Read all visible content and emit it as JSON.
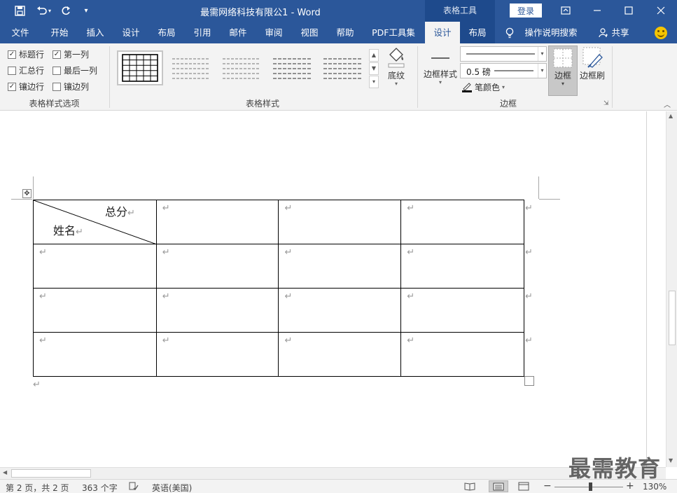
{
  "titlebar": {
    "doc_title": "最需网络科技有限公1  -  Word",
    "context_tab_group": "表格工具",
    "login": "登录"
  },
  "tabs": [
    {
      "label": "文件",
      "state": "normal"
    },
    {
      "label": "开始",
      "state": "normal"
    },
    {
      "label": "插入",
      "state": "normal"
    },
    {
      "label": "设计",
      "state": "normal"
    },
    {
      "label": "布局",
      "state": "normal"
    },
    {
      "label": "引用",
      "state": "normal"
    },
    {
      "label": "邮件",
      "state": "normal"
    },
    {
      "label": "审阅",
      "state": "normal"
    },
    {
      "label": "视图",
      "state": "normal"
    },
    {
      "label": "帮助",
      "state": "normal"
    },
    {
      "label": "PDF工具集",
      "state": "normal"
    },
    {
      "label": "设计",
      "state": "active"
    },
    {
      "label": "布局",
      "state": "context"
    }
  ],
  "tell_me": "操作说明搜索",
  "share": "共享",
  "ribbon": {
    "style_options": {
      "group_label": "表格样式选项",
      "checkboxes": [
        {
          "label": "标题行",
          "checked": true
        },
        {
          "label": "第一列",
          "checked": true
        },
        {
          "label": "汇总行",
          "checked": false
        },
        {
          "label": "最后一列",
          "checked": false
        },
        {
          "label": "镶边行",
          "checked": true
        },
        {
          "label": "镶边列",
          "checked": false
        }
      ]
    },
    "table_styles": {
      "group_label": "表格样式",
      "shading_label": "底纹"
    },
    "borders": {
      "group_label": "边框",
      "border_styles_label": "边框样式",
      "pen_weight": "0.5 磅",
      "pen_color_label": "笔颜色",
      "borders_label": "边框",
      "border_painter_label": "边框刷"
    }
  },
  "document": {
    "table": {
      "diagonal_header": {
        "top_right": "总分",
        "bottom_left": "姓名"
      },
      "rows": 4,
      "cols": 4,
      "cell_mark": "↵"
    },
    "end_mark": "↵"
  },
  "statusbar": {
    "page": "第 2 页，共 2 页",
    "words": "363 个字",
    "language": "英语(美国)",
    "zoom": "130%"
  },
  "watermark": "最需教育"
}
